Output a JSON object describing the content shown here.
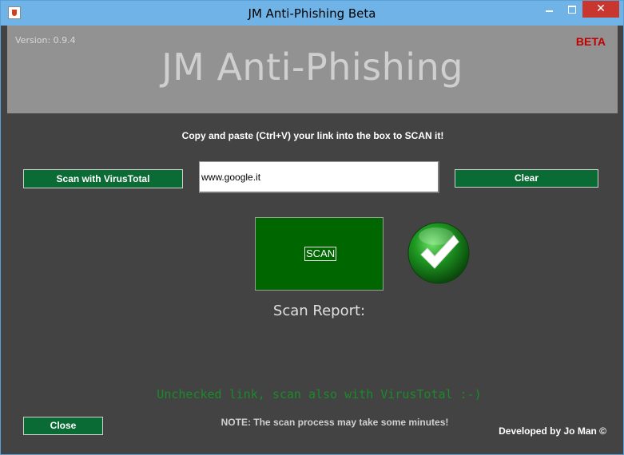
{
  "window": {
    "title": "JM Anti-Phishing Beta",
    "close_glyph": "✕"
  },
  "header": {
    "version": "Version: 0.9.4",
    "beta": "BETA",
    "title": "JM Anti-Phishing"
  },
  "main": {
    "instruction": "Copy and paste (Ctrl+V) your link into the box to SCAN it!",
    "scan_virustotal_label": "Scan with VirusTotal",
    "url_value": "www.google.it",
    "clear_label": "Clear",
    "scan_label": "SCAN",
    "result_icon": "check-icon",
    "scan_report_label": "Scan Report:",
    "status_message": "Unchecked link, scan also with VirusTotal :-)"
  },
  "footer": {
    "close_label": "Close",
    "note": "NOTE: The scan process may take some minutes!",
    "credit": "Developed by Jo Man ©"
  },
  "colors": {
    "titlebar": "#6fb3e7",
    "header_bg": "#929292",
    "body_bg": "#434343",
    "button_green": "#0b6b34",
    "scan_green": "#006600",
    "status_green": "#1a8a2a",
    "beta_red": "#c00000"
  }
}
